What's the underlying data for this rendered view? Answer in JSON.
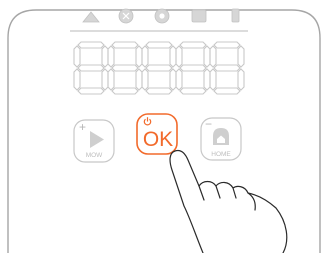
{
  "display": {
    "digits": "88888"
  },
  "buttons": {
    "mow": {
      "label": "MOW",
      "modifier": "+"
    },
    "ok": {
      "label": "OK",
      "active": true
    },
    "home": {
      "label": "HOME",
      "modifier": "−"
    }
  },
  "colors": {
    "accent": "#f26a2b",
    "segment_outline": "#c8c8c8",
    "panel_outline": "#a6a6a6",
    "icon_fill": "#d6d6d6",
    "hand_stroke": "#2b2b2b"
  },
  "icons": [
    "mountain-icon",
    "bug-icon",
    "settings-gear-icon",
    "square-icon",
    "battery-icon",
    "play-icon",
    "home-icon",
    "power-icon",
    "hand-pointer-icon"
  ]
}
